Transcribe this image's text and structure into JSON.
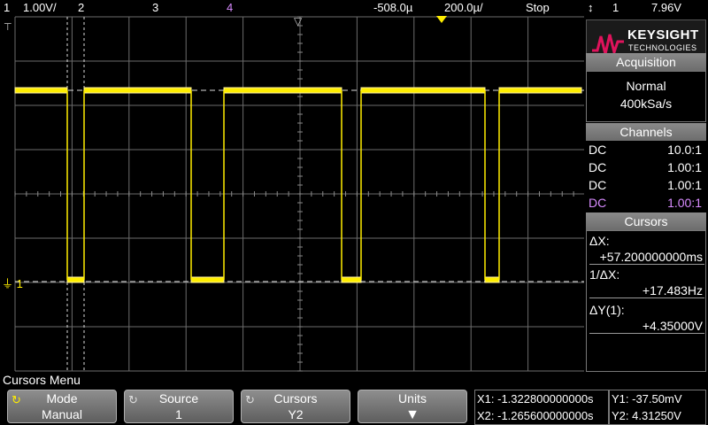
{
  "topbar": {
    "ch1_num": "1",
    "ch1_scale": "1.00V/",
    "ch2_num": "2",
    "ch3_num": "3",
    "ch4_num": "4",
    "time_offset": "-508.0µ",
    "time_scale": "200.0µ/",
    "run_state": "Stop",
    "trigger_icon": "↕",
    "trigger_source": "1",
    "trigger_level": "7.96V"
  },
  "screen": {
    "ground_marker": "⏚ 1",
    "trigger_point_icon": "▽"
  },
  "brand": {
    "name": "KEYSIGHT",
    "sub": "TECHNOLOGIES"
  },
  "acquisition": {
    "title": "Acquisition",
    "mode": "Normal",
    "rate": "400kSa/s"
  },
  "channels": {
    "title": "Channels",
    "rows": [
      {
        "coupling": "DC",
        "probe": "10.0:1",
        "color": "#ffffff"
      },
      {
        "coupling": "DC",
        "probe": "1.00:1",
        "color": "#ffffff"
      },
      {
        "coupling": "DC",
        "probe": "1.00:1",
        "color": "#ffffff"
      },
      {
        "coupling": "DC",
        "probe": "1.00:1",
        "color": "#d88bff"
      }
    ]
  },
  "cursors_panel": {
    "title": "Cursors",
    "dx_label": "ΔX:",
    "dx_value": "+57.200000000ms",
    "inv_dx_label": "1/ΔX:",
    "inv_dx_value": "+17.483Hz",
    "dy_label": "ΔY(1):",
    "dy_value": "+4.35000V"
  },
  "menu": {
    "title": "Cursors Menu",
    "softkeys": [
      {
        "label": "Mode",
        "value": "Manual"
      },
      {
        "label": "Source",
        "value": "1"
      },
      {
        "label": "Cursors",
        "value": "Y2"
      },
      {
        "label": "Units",
        "value": "▼"
      }
    ]
  },
  "readouts": {
    "x1": "X1: -1.322800000000s",
    "x2": "X2: -1.265600000000s",
    "y1": "Y1: -37.50mV",
    "y2": "Y2: 4.31250V"
  },
  "colors": {
    "trace": "#ffee00",
    "grid": "#6c6c6c",
    "ch4": "#d88bff",
    "logo_red": "#e0135c"
  }
}
